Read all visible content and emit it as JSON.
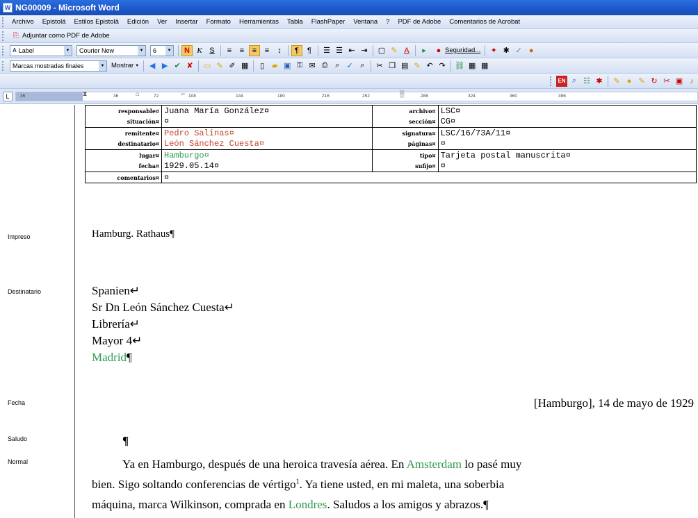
{
  "window": {
    "title": "NG00009 - Microsoft Word"
  },
  "menu": [
    "Archivo",
    "Epistolä",
    "Estilos Epistolä",
    "Edición",
    "Ver",
    "Insertar",
    "Formato",
    "Herramientas",
    "Tabla",
    "FlashPaper",
    "Ventana",
    "?",
    "PDF de Adobe",
    "Comentarios de Acrobat"
  ],
  "adobe_bar": {
    "label": "Adjuntar como PDF de Adobe"
  },
  "format_bar": {
    "style": "Label",
    "font": "Courier New",
    "size": "6",
    "security": "Seguridad..."
  },
  "review_bar": {
    "markup": "Marcas mostradas finales",
    "show": "Mostrar"
  },
  "ruler": {
    "ticks": [
      "36",
      "36",
      "72",
      "108",
      "144",
      "180",
      "216",
      "252",
      "288",
      "324",
      "360",
      "396"
    ]
  },
  "styles": {
    "impreso": "Impreso",
    "destinatario": "Destinatario",
    "fecha": "Fecha",
    "saludo": "Saludo",
    "normal": "Normal"
  },
  "meta": {
    "responsable_label": "responsable¤",
    "responsable": "Juana María González¤",
    "archivo_label": "archivo¤",
    "archivo": "LSC¤",
    "situacion_label": "situación¤",
    "situacion": "¤",
    "seccion_label": "sección¤",
    "seccion": "CG¤",
    "remitente_label": "remitente¤",
    "remitente": "Pedro Salinas¤",
    "signatura_label": "signatura¤",
    "signatura": "LSC/16/73A/11¤",
    "destinatario_label": "destinatario¤",
    "destinatario": "León Sánchez Cuesta¤",
    "paginas_label": "páginas¤",
    "paginas": "¤",
    "lugar_label": "lugar¤",
    "lugar": "Hamburgo¤",
    "tipo_label": "tipo¤",
    "tipo": "Tarjeta postal manuscrita¤",
    "fecha_label": "fecha¤",
    "fecha": "1929.05.14¤",
    "sufijo_label": "sufijo¤",
    "sufijo": "¤",
    "comentarios_label": "comentarios¤",
    "comentarios": "¤"
  },
  "letter": {
    "impreso": "Hamburg. Rathaus¶",
    "dest_1": "Spanien↵",
    "dest_2": "Sr Dn León Sánchez Cuesta↵",
    "dest_3": "Librería↵",
    "dest_4": "Mayor 4↵",
    "dest_5": "Madrid",
    "dest_5_mark": "¶",
    "fecha": "[Hamburgo], 14 de mayo de 1929",
    "saludo": "¶",
    "p1_a": "Ya en Hamburgo, después de una heroica travesía aérea. En ",
    "p1_b": "Amsterdam",
    "p1_c": " lo pasé muy",
    "p2_a": "bien. Sigo soltando conferencias de vértigo",
    "p2_sup": "1",
    "p2_b": ". Ya tiene usted, en mi maleta, una soberbia",
    "p3_a": "máquina, marca Wilkinson, comprada en ",
    "p3_b": "Londres",
    "p3_c": ". Saludos a los amigos y abrazos.¶"
  },
  "colors": {
    "green": "#2e9b50",
    "red": "#c0462b",
    "titlebar": "#1d57c9"
  }
}
